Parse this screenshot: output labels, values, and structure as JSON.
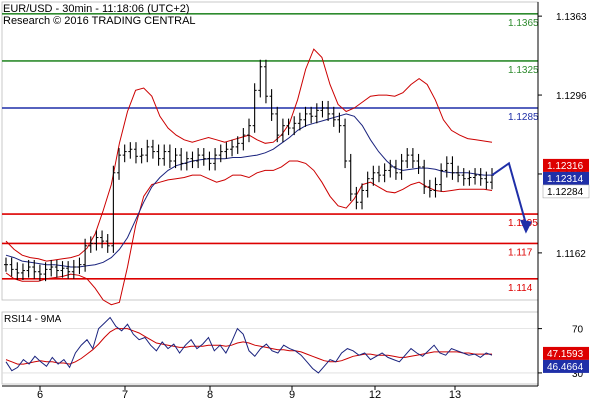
{
  "header": {
    "line1": "EUR/USD - 30min - 11:18:06 (UTC+2)",
    "line2": "Research © 2016 TRADING CENTRAL"
  },
  "colors": {
    "background": "#ffffff",
    "price": "#000000",
    "bollinger": "#cc0000",
    "moving_average": "#1a237e",
    "resistance_green": "#2e8b2e",
    "pivot_blue": "#1f2fa8",
    "support_red": "#dd0000",
    "current_price_bg": "#1f2fa8",
    "current_ask_bg": "#dd0000",
    "rsi_line": "#1a237e",
    "rsi_ma": "#cc0000"
  },
  "chart_data": [
    {
      "type": "line",
      "name": "price",
      "title": "EUR/USD - 30min - 11:18:06 (UTC+2)",
      "x_tick_labels": [
        "6",
        "7",
        "8",
        "9",
        "12",
        "13"
      ],
      "y_tick_labels": [
        1.1363,
        1.1296,
        1.1229,
        1.1162
      ],
      "ylim": [
        1.1122,
        1.1375
      ],
      "scale_labels": [
        1.1363,
        1.1296,
        1.1162
      ],
      "levels": [
        {
          "value": 1.1365,
          "label": "1.1365",
          "color": "#2e8b2e"
        },
        {
          "value": 1.1325,
          "label": "1.1325",
          "color": "#2e8b2e"
        },
        {
          "value": 1.1285,
          "label": "1.1285",
          "color": "#1f2fa8"
        },
        {
          "value": 1.1195,
          "label": "1.1195",
          "color": "#dd0000"
        },
        {
          "value": 1.117,
          "label": "1.117",
          "color": "#dd0000"
        },
        {
          "value": 1.114,
          "label": "1.114",
          "color": "#dd0000"
        }
      ],
      "price_boxes": [
        {
          "value": 1.12316,
          "label": "1.12316",
          "color": "#dd0000"
        },
        {
          "value": 1.12314,
          "label": "1.12314",
          "color": "#1f2fa8"
        },
        {
          "value": 1.12284,
          "label": "1.12284",
          "color": "#ffffff"
        }
      ],
      "close": [
        1.1152,
        1.1148,
        1.1145,
        1.1147,
        1.115,
        1.1146,
        1.1144,
        1.1148,
        1.115,
        1.1147,
        1.1149,
        1.1146,
        1.115,
        1.1152,
        1.1168,
        1.117,
        1.1175,
        1.1172,
        1.1168,
        1.123,
        1.1245,
        1.1248,
        1.125,
        1.1244,
        1.1245,
        1.1252,
        1.1248,
        1.1242,
        1.1248,
        1.124,
        1.1245,
        1.1238,
        1.1242,
        1.124,
        1.1245,
        1.1242,
        1.1238,
        1.1245,
        1.1248,
        1.125,
        1.1252,
        1.1255,
        1.1262,
        1.127,
        1.13,
        1.132,
        1.1295,
        1.128,
        1.1262,
        1.127,
        1.1268,
        1.1272,
        1.1275,
        1.128,
        1.1278,
        1.1283,
        1.1285,
        1.128,
        1.1275,
        1.127,
        1.124,
        1.1212,
        1.1205,
        1.1215,
        1.1225,
        1.123,
        1.1228,
        1.1232,
        1.1235,
        1.123,
        1.124,
        1.1245,
        1.124,
        1.1235,
        1.1218,
        1.1215,
        1.122,
        1.1232,
        1.1238,
        1.123,
        1.1228,
        1.1225,
        1.1226,
        1.1228,
        1.1225,
        1.1222,
        1.1228
      ],
      "bb_upper": [
        1.1172,
        1.1165,
        1.116,
        1.1158,
        1.1157,
        1.1155,
        1.1156,
        1.1157,
        1.1158,
        1.116,
        1.1166,
        1.1178,
        1.1198,
        1.122,
        1.1255,
        1.1282,
        1.13,
        1.1302,
        1.1295,
        1.1278,
        1.1268,
        1.1262,
        1.1258,
        1.1256,
        1.1258,
        1.126,
        1.1258,
        1.1256,
        1.1258,
        1.126,
        1.1262,
        1.1258,
        1.1255,
        1.1256,
        1.1262,
        1.1272,
        1.1292,
        1.1318,
        1.1335,
        1.1328,
        1.1305,
        1.1288,
        1.1282,
        1.1285,
        1.129,
        1.1295,
        1.1296,
        1.1296,
        1.1295,
        1.1298,
        1.1305,
        1.131,
        1.1305,
        1.1292,
        1.1275,
        1.1266,
        1.1262,
        1.1259,
        1.1258,
        1.1257,
        1.1256
      ],
      "bb_lower": [
        1.1145,
        1.114,
        1.1138,
        1.1138,
        1.1138,
        1.114,
        1.1141,
        1.1142,
        1.1144,
        1.1143,
        1.114,
        1.1132,
        1.1122,
        1.1118,
        1.112,
        1.115,
        1.1185,
        1.121,
        1.122,
        1.1222,
        1.1224,
        1.1225,
        1.1226,
        1.1228,
        1.1228,
        1.1225,
        1.1222,
        1.1224,
        1.1228,
        1.1228,
        1.1226,
        1.123,
        1.1232,
        1.1232,
        1.1235,
        1.124,
        1.124,
        1.1238,
        1.1232,
        1.1222,
        1.121,
        1.1202,
        1.12,
        1.1208,
        1.122,
        1.1222,
        1.1218,
        1.1214,
        1.1213,
        1.1216,
        1.122,
        1.1222,
        1.1218,
        1.1215,
        1.1214,
        1.1215,
        1.1216,
        1.1216,
        1.1216,
        1.1216,
        1.1215
      ],
      "ma": [
        1.116,
        1.1158,
        1.1155,
        1.1154,
        1.1153,
        1.1152,
        1.1152,
        1.1151,
        1.115,
        1.115,
        1.1151,
        1.1152,
        1.1154,
        1.1158,
        1.1165,
        1.1175,
        1.119,
        1.1205,
        1.1218,
        1.1226,
        1.1232,
        1.1236,
        1.1238,
        1.124,
        1.1241,
        1.1242,
        1.1242,
        1.1242,
        1.1243,
        1.1243,
        1.1244,
        1.1245,
        1.1247,
        1.125,
        1.1255,
        1.126,
        1.1266,
        1.127,
        1.1272,
        1.1274,
        1.1276,
        1.1278,
        1.128,
        1.1278,
        1.127,
        1.1258,
        1.1248,
        1.124,
        1.1234,
        1.1232,
        1.1233,
        1.1234,
        1.1234,
        1.1233,
        1.1231,
        1.123,
        1.123,
        1.123,
        1.1229,
        1.1228,
        1.1228
      ],
      "forecast": [
        {
          "x": 86,
          "y": 1.1228
        },
        {
          "x": 89,
          "y": 1.1238
        },
        {
          "x": 92,
          "y": 1.118
        }
      ],
      "grid": false
    },
    {
      "type": "line",
      "name": "rsi",
      "title": "RSI14 - 9MA",
      "y_tick_labels": [
        70,
        30
      ],
      "ylim": [
        20,
        85
      ],
      "value_boxes": [
        {
          "value": 47.1593,
          "label": "47.1593",
          "color": "#dd0000"
        },
        {
          "value": 46.4664,
          "label": "46.4664",
          "color": "#1f2fa8"
        }
      ],
      "levels": [
        70,
        30
      ],
      "rsi": [
        40,
        32,
        35,
        42,
        38,
        45,
        40,
        36,
        44,
        38,
        42,
        35,
        48,
        55,
        60,
        52,
        70,
        75,
        80,
        72,
        68,
        74,
        65,
        60,
        62,
        55,
        50,
        58,
        52,
        56,
        48,
        55,
        60,
        52,
        56,
        62,
        50,
        55,
        48,
        58,
        70,
        65,
        50,
        45,
        52,
        56,
        50,
        48,
        55,
        52,
        50,
        46,
        40,
        34,
        30,
        36,
        42,
        40,
        48,
        52,
        50,
        46,
        48,
        42,
        45,
        48,
        44,
        42,
        40,
        46,
        52,
        48,
        45,
        50,
        55,
        48,
        46,
        52,
        50,
        48,
        46,
        47,
        44,
        48,
        46
      ],
      "rsi_ma": [
        42,
        40,
        38,
        38,
        39,
        40,
        41,
        40,
        40,
        39,
        39,
        38,
        40,
        43,
        47,
        51,
        56,
        62,
        67,
        70,
        70,
        70,
        68,
        66,
        63,
        60,
        57,
        56,
        55,
        54,
        53,
        53,
        54,
        54,
        54,
        55,
        55,
        55,
        54,
        55,
        57,
        58,
        57,
        55,
        54,
        53,
        52,
        51,
        51,
        50,
        50,
        49,
        47,
        45,
        43,
        41,
        40,
        40,
        41,
        43,
        45,
        46,
        47,
        47,
        46,
        46,
        46,
        45,
        44,
        44,
        45,
        46,
        47,
        48,
        49,
        49,
        49,
        49,
        49,
        48,
        48,
        47,
        47,
        47,
        47
      ]
    }
  ]
}
